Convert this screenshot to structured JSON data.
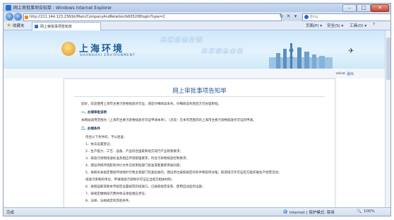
{
  "window": {
    "title": "网上审批事项告知单 - Windows Internet Explorer",
    "minimize": "–",
    "maximize": "□",
    "close": "✕"
  },
  "addressbar": {
    "url": "http://211.144.123.236/bt/Main/CompanyAndRelation/b605208login?type=2",
    "refresh": "↻",
    "stop": "✕",
    "go": "▾",
    "search_engine": "Bing"
  },
  "tabs": {
    "favorites": "收藏夹",
    "active_tab": "网上审批事项告知单",
    "commands": [
      "页面(P) ▾",
      "安全(S) ▾",
      "工具(O) ▾",
      "?"
    ]
  },
  "banner": {
    "logo_cn": "上海环境",
    "logo_en": "SHANGHAI ENVIRONMENT",
    "slogan1": "共建生态文明",
    "slogan2": "共享绿色未来"
  },
  "breadcrumb": {
    "user": "value",
    "back": "退出"
  },
  "notice": {
    "title": "网上审批事项告知单",
    "lines": [
      {
        "text": "您好，欢迎使用上海市主要污染物排放许可证，请您仔细阅读本条，仔细阅读条款后方可办理审批。",
        "h": false
      },
      {
        "text": "一、办理审批说明",
        "h": true
      },
      {
        "text": "本网站适用范围为（上海市主要污染物排放许可证申请本单）、（涉及）在本市范围内的上海市主要污染物排放许可证的申请。",
        "h": false
      },
      {
        "text": "二、办理条件",
        "h": true
      },
      {
        "text": "符合以下条件的，予以批准：",
        "h": false
      },
      {
        "text": "1、依法设置登记；",
        "h": false
      },
      {
        "text": "2、生产能力、工艺、设备、产品符合国家和地方现行产业政策要求；",
        "h": false
      },
      {
        "text": "3、排放污染物排放标准及相应环境管理要求，符合污染物排放控制要求；",
        "h": false
      },
      {
        "text": "4、建设项目环境影响评价文件已经审批部门批准或者重新审核同意；",
        "h": false
      },
      {
        "text": "5、依照有关规定需经环境保护行政主管部门检查验收的，建设单位按照规定的条件和程序办理，取得排污许可证后方能开展生产经营活动；",
        "h": false
      },
      {
        "text": "   排放污染物的单位，申请排放污染物许可证应当提交相关材料；",
        "h": false
      },
      {
        "text": "6、按照国家或者本市规定设置规范的排放口，已按照规定安装、使用自动监控设施；",
        "h": false
      },
      {
        "text": "7、按规定缴纳排污费并依法承担相应责任；",
        "h": false
      },
      {
        "text": "8、法律、法规规定的其他条件。",
        "h": false
      }
    ]
  },
  "statusbar": {
    "left": "完成",
    "zone": "Internet | 保护模式: 禁用",
    "zoom": "100%"
  },
  "colors": {
    "accent": "#2d5d9a",
    "frame": "#dbe6f4"
  }
}
